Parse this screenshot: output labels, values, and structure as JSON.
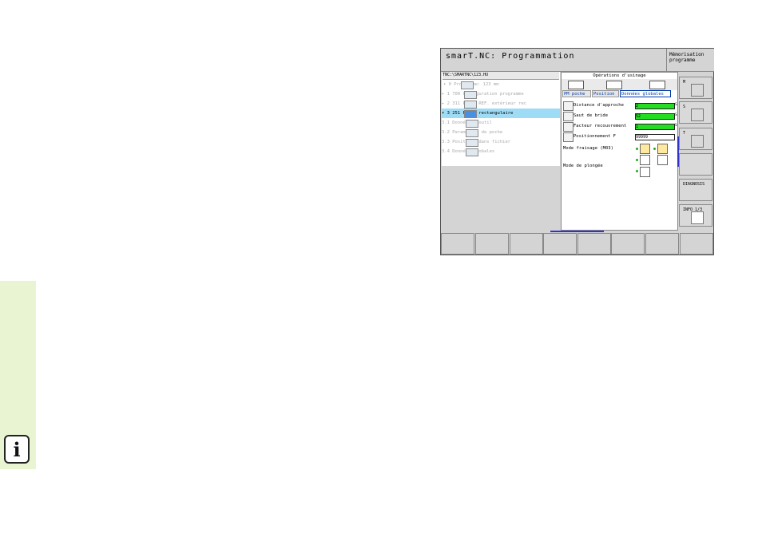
{
  "title": "smarT.NC: Programmation",
  "memo_button": "Mémorisation\nprogramme",
  "tree": {
    "path": "TNC:\\SMARTNC\\123.HU",
    "rows": [
      {
        "label": "▾ 0      Programme: 123 mm",
        "active": false
      },
      {
        "label": "  ▸ 1      700 Configuration programme",
        "active": false
      },
      {
        "label": "  ▸ 2      311 PT DE REF. extérieur rec",
        "active": false
      },
      {
        "label": "  ▾ 3      251 Poche rectangulaire",
        "active": true
      },
      {
        "label": "    3.1      Données d'outil",
        "active": false
      },
      {
        "label": "    3.2      Paramètres de poche",
        "active": false
      },
      {
        "label": "    3.3      Positions dans fichier",
        "active": false
      },
      {
        "label": "    3.4      Données globales",
        "active": false
      }
    ]
  },
  "form": {
    "header": "Opérations d'usinage",
    "tabs": [
      "PM poche",
      "Position",
      "Données globales"
    ],
    "fields": [
      {
        "label": "Distance d'approche",
        "value": "2",
        "unit": "S"
      },
      {
        "label": "Saut de bride",
        "value": "52",
        "unit": "S"
      },
      {
        "label": "Facteur recouvrement",
        "value": "1",
        "unit": "S"
      },
      {
        "label": "Positionnement F",
        "value": "99999",
        "unit": ""
      }
    ],
    "mode_fraisage": "Mode fraisage (M03)",
    "mode_plongee": "Mode de plongée"
  },
  "softkeys_v": [
    {
      "key": "M"
    },
    {
      "key": "S"
    },
    {
      "key": "T"
    },
    {
      "key": ""
    },
    {
      "key": "DIAGNOSIS"
    },
    {
      "key": "INFO 1/3"
    }
  ],
  "info_icon_label": "i"
}
